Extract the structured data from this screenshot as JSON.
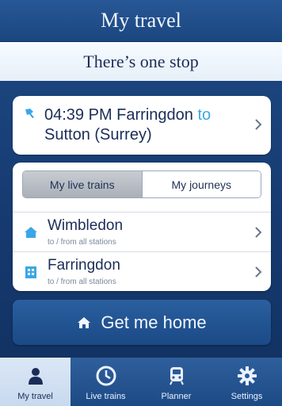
{
  "header": {
    "title": "My travel"
  },
  "subheader": {
    "title": "There’s one stop"
  },
  "stop": {
    "time_origin": "04:39 PM Farringdon",
    "to_word": "to",
    "destination": "Sutton (Surrey)"
  },
  "segmented": {
    "live_label": "My live trains",
    "journeys_label": "My journeys"
  },
  "stations": [
    {
      "name": "Wimbledon",
      "sub": "to / from all stations"
    },
    {
      "name": "Farringdon",
      "sub": "to / from all stations"
    }
  ],
  "home_button": {
    "label": "Get me home"
  },
  "tabs": [
    {
      "label": "My travel"
    },
    {
      "label": "Live trains"
    },
    {
      "label": "Planner"
    },
    {
      "label": "Settings"
    }
  ],
  "colors": {
    "brand_blue": "#1f4f8c",
    "to_blue": "#3aa7e6",
    "text_dark": "#1b2d57"
  }
}
